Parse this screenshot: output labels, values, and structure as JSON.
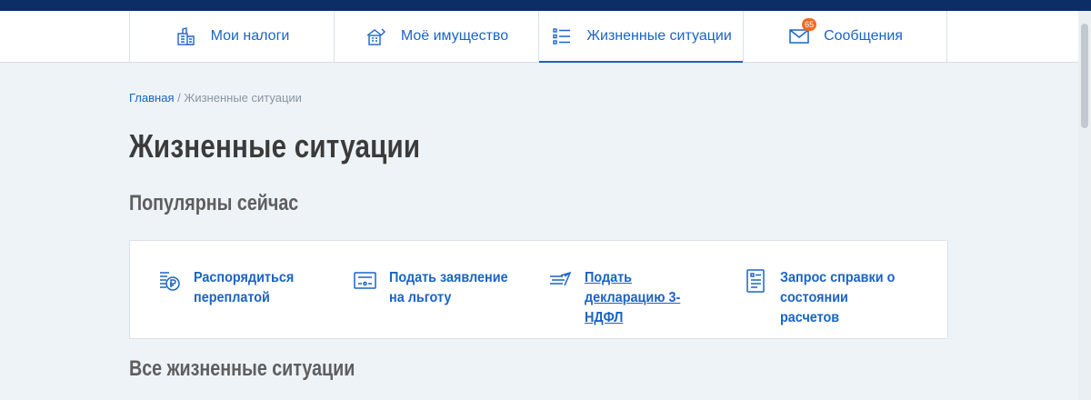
{
  "nav": {
    "items": [
      {
        "label": "Мои налоги",
        "icon": "tax-building-icon"
      },
      {
        "label": "Моё имущество",
        "icon": "property-house-icon"
      },
      {
        "label": "Жизненные ситуации",
        "icon": "list-icon"
      },
      {
        "label": "Сообщения",
        "icon": "envelope-icon",
        "badge": "65"
      }
    ],
    "active_index": 2
  },
  "breadcrumb": {
    "home": "Главная",
    "separator": " / ",
    "current": "Жизненные ситуации"
  },
  "page": {
    "title": "Жизненные ситуации",
    "popular_title": "Популярны сейчас",
    "all_title": "Все жизненные ситуации"
  },
  "popular": [
    {
      "label": "Распорядиться переплатой",
      "icon": "ruble-coin-icon"
    },
    {
      "label": "Подать заявление на льготу",
      "icon": "benefit-form-icon"
    },
    {
      "label": "Подать декларацию 3-НДФЛ",
      "icon": "declaration-icon"
    },
    {
      "label": "Запрос справки о состоянии расчетов",
      "icon": "certificate-icon"
    }
  ],
  "colors": {
    "accent": "#1b64c6",
    "header_band": "#0b2e67",
    "badge": "#f36a22",
    "background": "#eef3f7"
  }
}
